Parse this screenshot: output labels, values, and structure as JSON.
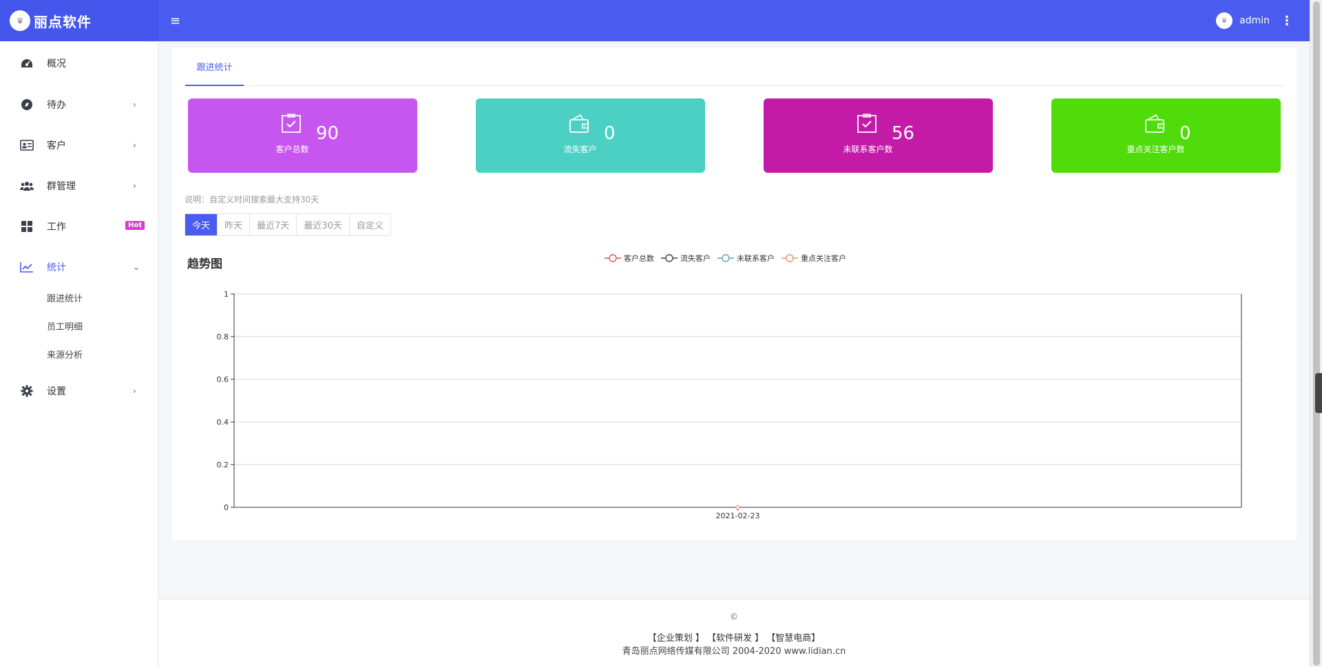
{
  "header": {
    "brand_name": "丽点软件",
    "logo_glyph": "♛",
    "menu_toggle": "≡",
    "username": "admin",
    "more_glyph": "⋮"
  },
  "sidebar": {
    "items": [
      {
        "label": "概况",
        "icon": "dashboard-icon"
      },
      {
        "label": "待办",
        "icon": "compass-icon"
      },
      {
        "label": "客户",
        "icon": "id-card-icon"
      },
      {
        "label": "群管理",
        "icon": "users-icon"
      },
      {
        "label": "工作",
        "icon": "grid-icon",
        "badge": "Hot"
      },
      {
        "label": "统计",
        "icon": "line-chart-icon"
      },
      {
        "label": "设置",
        "icon": "gear-icon"
      }
    ],
    "stats_children": [
      "跟进统计",
      "员工明细",
      "来源分析"
    ]
  },
  "tabs": {
    "active": "跟进统计"
  },
  "stats": [
    {
      "value": "90",
      "label": "客户总数",
      "color": "#c755f0",
      "icon": "checkbox-icon"
    },
    {
      "value": "0",
      "label": "流失客户",
      "color": "#4dd0c4",
      "icon": "wallet-icon"
    },
    {
      "value": "56",
      "label": "未联系客户数",
      "color": "#c41aa8",
      "icon": "checkbox-icon"
    },
    {
      "value": "0",
      "label": "重点关注客户数",
      "color": "#4fdc0a",
      "icon": "wallet-icon"
    }
  ],
  "note": "说明：自定义时间搜索最大支持30天",
  "range_buttons": [
    "今天",
    "昨天",
    "最近7天",
    "最近30天",
    "自定义"
  ],
  "chart_data": {
    "type": "line",
    "title": "趋势图",
    "x": [
      "2021-02-23"
    ],
    "series": [
      {
        "name": "客户总数",
        "values": [
          0
        ],
        "color": "#d9534f"
      },
      {
        "name": "流失客户",
        "values": [
          0
        ],
        "color": "#2f4554"
      },
      {
        "name": "未联系客户",
        "values": [
          0
        ],
        "color": "#61a0a8"
      },
      {
        "name": "重点关注客户",
        "values": [
          0
        ],
        "color": "#e98f6f"
      }
    ],
    "ylim": [
      0,
      1
    ],
    "yticks": [
      "0",
      "0.2",
      "0.4",
      "0.6",
      "0.8",
      "1"
    ],
    "grid": true,
    "legend": "top-center"
  },
  "footer": {
    "copyright": "©",
    "links": [
      "【企业策划 】",
      "【软件研发 】",
      "【智慧电商】"
    ],
    "company": "青岛丽点网络传媒有限公司 2004-2020 www.lidian.cn"
  }
}
